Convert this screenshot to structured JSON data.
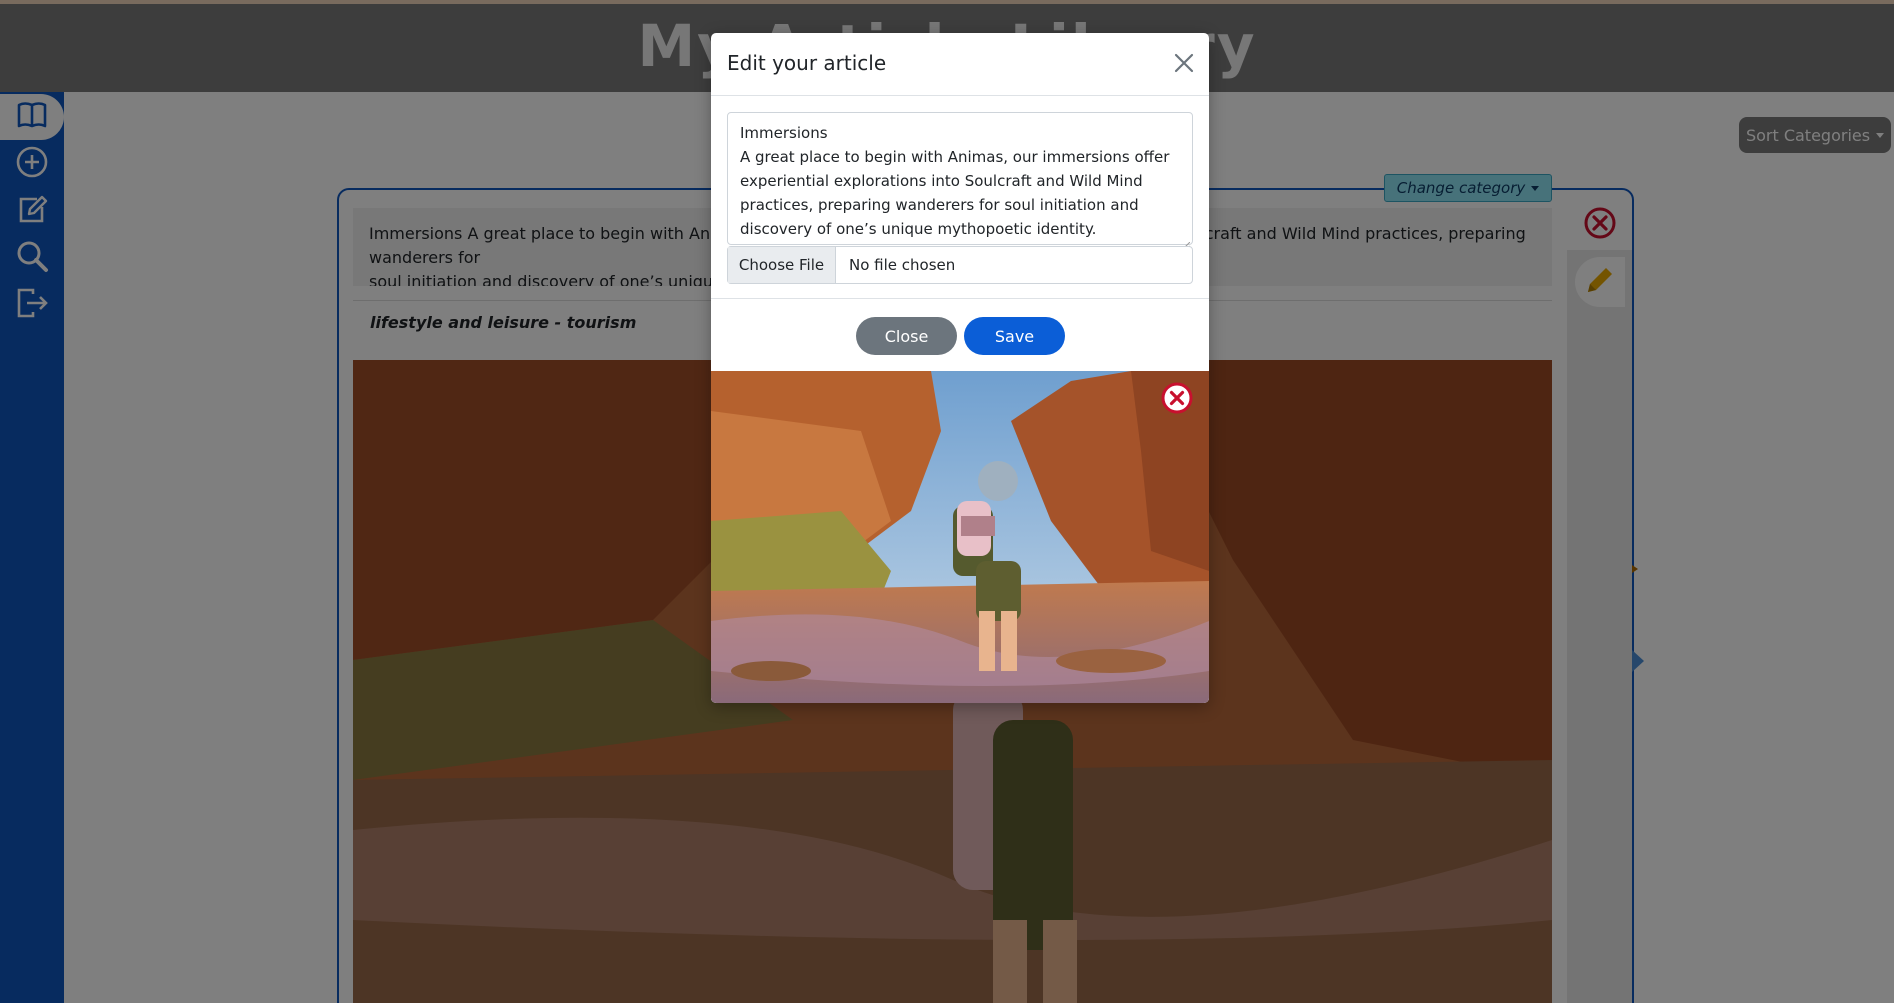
{
  "app": {
    "title": "My Article Library"
  },
  "sidebar": {
    "items": [
      {
        "icon": "book-icon",
        "label": "Articles"
      },
      {
        "icon": "plus-circle-icon",
        "label": "Add article"
      },
      {
        "icon": "edit-icon",
        "label": "Edit"
      },
      {
        "icon": "search-icon",
        "label": "Search"
      },
      {
        "icon": "logout-icon",
        "label": "Log out"
      }
    ],
    "accent_color": "#0f57bf"
  },
  "toolbar": {
    "sort_label": "Sort Categories"
  },
  "article_card": {
    "change_category_label": "Change category",
    "text_line1": "Immersions A great place to begin with Animas, our immersions offer experiential explorations into Soulcraft and Wild Mind practices, preparing wanderers for",
    "text_line2": "soul initiation and discovery of one’s unique mythopoetic identity.",
    "category": "lifestyle and leisure - tourism"
  },
  "modal": {
    "title": "Edit your article",
    "textarea_value": "Immersions\nA great place to begin with Animas, our immersions offer experiential explorations into Soulcraft and Wild Mind practices, preparing wanderers for soul initiation and discovery of one’s unique mythopoetic identity.",
    "file_button_label": "Choose File",
    "file_status": "No file chosen",
    "close_label": "Close",
    "save_label": "Save",
    "primary_color": "#0b5ed7",
    "secondary_color": "#6c757d",
    "danger_color": "#c8102e"
  }
}
